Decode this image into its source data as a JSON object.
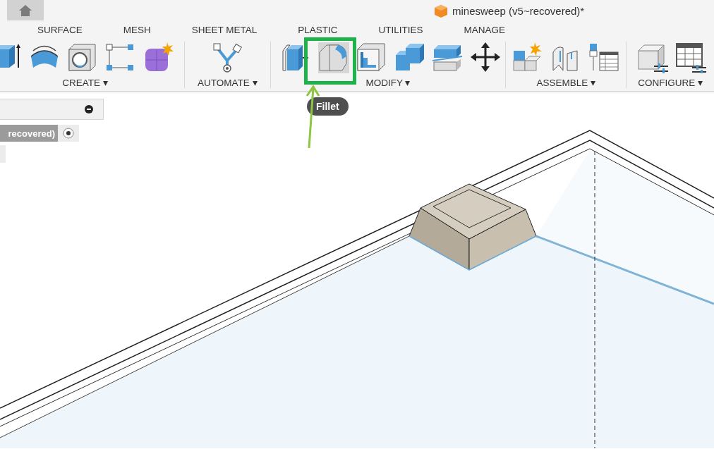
{
  "document": {
    "title": "minesweep (v5~recovered)*"
  },
  "tabs": [
    {
      "label": "SURFACE"
    },
    {
      "label": "MESH"
    },
    {
      "label": "SHEET METAL"
    },
    {
      "label": "PLASTIC"
    },
    {
      "label": "UTILITIES"
    },
    {
      "label": "MANAGE"
    }
  ],
  "toolbar_groups": [
    {
      "label": "CREATE",
      "caret": "▾",
      "tools": [
        {
          "kind": "extrude",
          "hovered": false
        },
        {
          "kind": "sweep",
          "hovered": false
        },
        {
          "kind": "hole",
          "hovered": false
        },
        {
          "kind": "points",
          "hovered": false
        },
        {
          "kind": "form",
          "hovered": false
        }
      ]
    },
    {
      "label": "AUTOMATE",
      "caret": "▾",
      "tools": [
        {
          "kind": "automate",
          "hovered": false
        }
      ]
    },
    {
      "label": "MODIFY",
      "caret": "▾",
      "tools": [
        {
          "kind": "presspull",
          "hovered": false
        },
        {
          "kind": "fillet",
          "hovered": true
        },
        {
          "kind": "shell",
          "hovered": false
        },
        {
          "kind": "combine",
          "hovered": false
        },
        {
          "kind": "split",
          "hovered": false
        },
        {
          "kind": "move",
          "hovered": false
        }
      ]
    },
    {
      "label": "ASSEMBLE",
      "caret": "▾",
      "tools": [
        {
          "kind": "component",
          "hovered": false
        },
        {
          "kind": "joint",
          "hovered": false
        },
        {
          "kind": "bom",
          "hovered": false
        }
      ]
    },
    {
      "label": "CONFIGURE",
      "caret": "▾",
      "tools": [
        {
          "kind": "configure",
          "hovered": false
        },
        {
          "kind": "configtable",
          "hovered": false
        }
      ]
    }
  ],
  "tooltip": {
    "text": "Fillet"
  },
  "browser": {
    "item": {
      "label": "recovered)",
      "selected": true
    }
  }
}
